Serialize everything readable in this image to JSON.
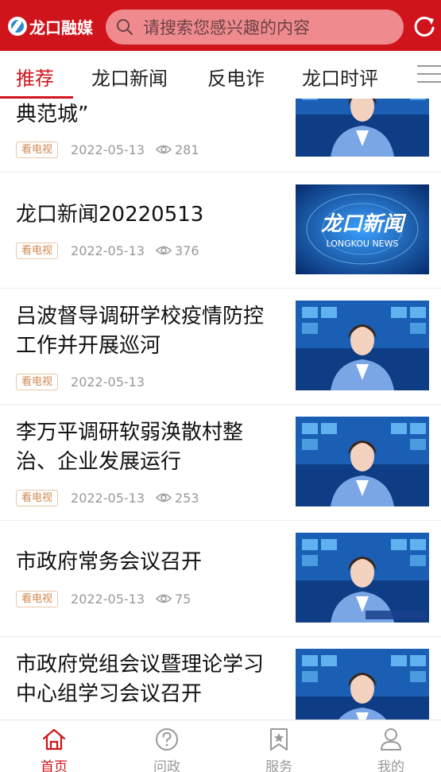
{
  "header": {
    "logo_text": "龙口融媒",
    "search_placeholder": "请搜索您感兴趣的内容",
    "brand_color": "#d0141c"
  },
  "tabs": [
    {
      "label": "推荐",
      "active": true
    },
    {
      "label": "龙口新闻",
      "active": false
    },
    {
      "label": "反电诈",
      "active": false
    },
    {
      "label": "龙口时评",
      "active": false
    }
  ],
  "feed": {
    "items": [
      {
        "title": "典范城”",
        "tag": "看电视",
        "date": "2022-05-13",
        "views": "281",
        "thumb": "anchor"
      },
      {
        "title": "龙口新闻20220513",
        "tag": "看电视",
        "date": "2022-05-13",
        "views": "376",
        "thumb": "logo"
      },
      {
        "title": "吕波督导调研学校疫情防控工作并开展巡河",
        "tag": "看电视",
        "date": "2022-05-13",
        "views": "",
        "thumb": "anchor"
      },
      {
        "title": "李万平调研软弱涣散村整治、企业发展运行",
        "tag": "看电视",
        "date": "2022-05-13",
        "views": "253",
        "thumb": "anchor"
      },
      {
        "title": "市政府常务会议召开",
        "tag": "看电视",
        "date": "2022-05-13",
        "views": "75",
        "thumb": "anchor"
      },
      {
        "title": "市政府党组会议暨理论学习中心组学习会议召开",
        "tag": "",
        "date": "",
        "views": "",
        "thumb": "anchor"
      }
    ],
    "news_logo_text": "龙口新闻",
    "news_logo_sub": "LONGKOU NEWS"
  },
  "bottom_nav": [
    {
      "label": "首页",
      "icon": "home-icon",
      "active": true
    },
    {
      "label": "问政",
      "icon": "question-icon",
      "active": false
    },
    {
      "label": "服务",
      "icon": "star-bookmark-icon",
      "active": false
    },
    {
      "label": "我的",
      "icon": "user-icon",
      "active": false
    }
  ]
}
